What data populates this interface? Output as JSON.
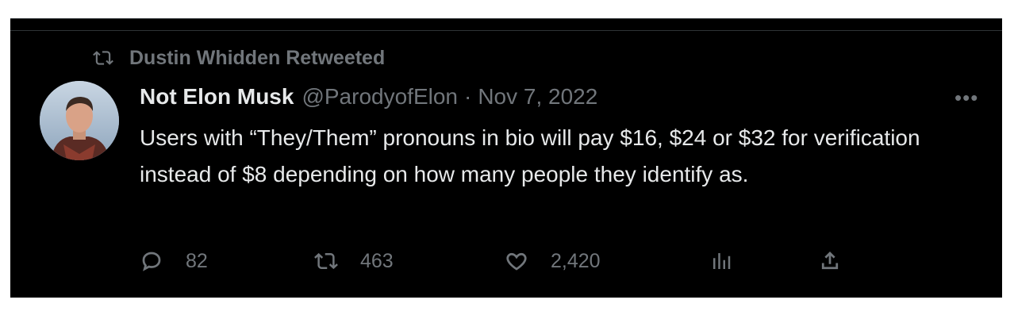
{
  "colors": {
    "background": "#000000",
    "text": "#e7e9ea",
    "muted": "#71767b"
  },
  "retweet_context": {
    "label": "Dustin Whidden Retweeted",
    "icon": "retweet-icon"
  },
  "author": {
    "name": "Not Elon Musk",
    "handle": "@ParodyofElon",
    "separator": "·",
    "date": "Nov 7, 2022"
  },
  "more_icon": "more-icon",
  "text": "Users with “They/Them” pronouns in bio will pay $16, $24 or $32 for verification instead of $8 depending on how many people they identify as.",
  "actions": {
    "replies": {
      "icon": "reply-icon",
      "count": "82"
    },
    "retweets": {
      "icon": "retweet-icon",
      "count": "463"
    },
    "likes": {
      "icon": "heart-icon",
      "count": "2,420"
    },
    "views": {
      "icon": "views-icon"
    },
    "share": {
      "icon": "share-icon"
    }
  }
}
